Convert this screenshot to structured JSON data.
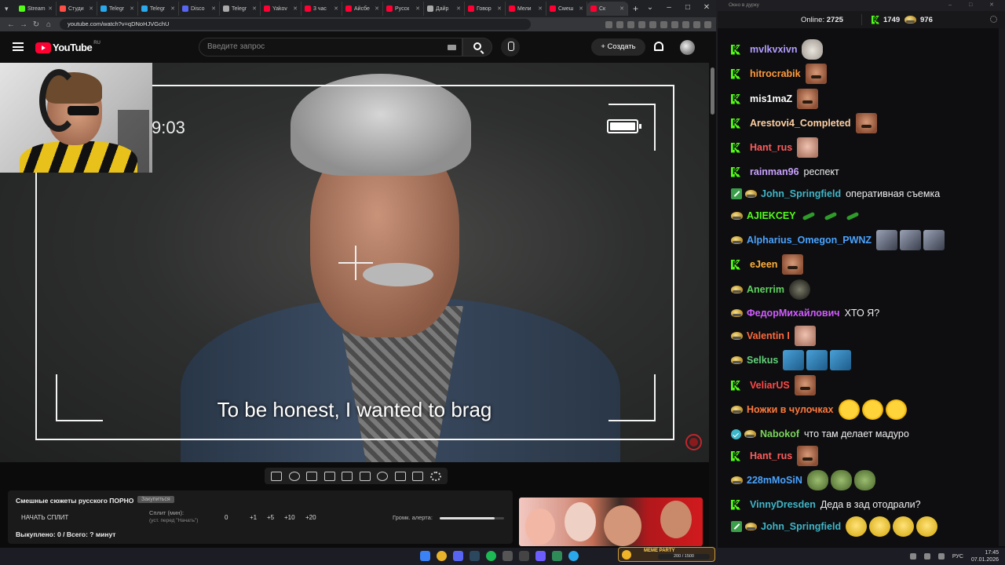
{
  "browser": {
    "tabs": [
      {
        "label": "Stream",
        "color": "#53fc18"
      },
      {
        "label": "Студи",
        "color": "#ff4e45"
      },
      {
        "label": "Telegr",
        "color": "#29a9eb"
      },
      {
        "label": "Telegr",
        "color": "#29a9eb"
      },
      {
        "label": "Disco",
        "color": "#5865f2"
      },
      {
        "label": "Telegr",
        "color": "#aaaaaa"
      },
      {
        "label": "Yakov",
        "color": "#ff0033"
      },
      {
        "label": "3 час",
        "color": "#ff0033"
      },
      {
        "label": "Айсбе",
        "color": "#ff0033"
      },
      {
        "label": "Русск",
        "color": "#ff0033"
      },
      {
        "label": "Дайр",
        "color": "#aaaaaa"
      },
      {
        "label": "Говор",
        "color": "#ff0033"
      },
      {
        "label": "Мели",
        "color": "#ff0033"
      },
      {
        "label": "Смеш",
        "color": "#ff0033"
      },
      {
        "label": "Ск",
        "color": "#ff0033"
      }
    ],
    "url": "youtube.com/watch?v=qDNoHJVGchU"
  },
  "youtube": {
    "logo_text": "YouTube",
    "region": "RU",
    "search_placeholder": "Введите запрос",
    "create_label": "Создать"
  },
  "video": {
    "timestamp": "9:03",
    "subtitle": "To be honest, I wanted to brag"
  },
  "panel": {
    "title": "Смешные сюжеты русского ПОРНО",
    "tag": "Закупиться",
    "start_split": "НАЧАТЬ СПЛИТ",
    "split_label": "Сплит (мин):",
    "split_hint": "(уст. перед \"Начать\")",
    "split_value": "0",
    "increments": [
      "+1",
      "+5",
      "+10",
      "+20"
    ],
    "volume_label": "Громк. алерта:",
    "volume_level": 0.85,
    "bought": "Выкуплено: 0 / Всего: ? минут"
  },
  "chat": {
    "window_title": "Окно в дурку",
    "online_label": "Online:",
    "online_count": "2725",
    "kick_count": "1749",
    "pot_count": "976",
    "messages": [
      {
        "badges": [
          "kick"
        ],
        "user": "mvlkvxivn",
        "color": "#b39dff",
        "text": "",
        "emotes": [
          "cat"
        ]
      },
      {
        "badges": [
          "kick"
        ],
        "user": "hitrocrabik",
        "color": "#ff9a3c",
        "text": "",
        "emotes": [
          "face"
        ]
      },
      {
        "badges": [
          "kick"
        ],
        "user": "mis1maZ",
        "color": "#ffffff",
        "text": "",
        "emotes": [
          "face"
        ]
      },
      {
        "badges": [
          "kick"
        ],
        "user": "Arestovi4_Completed",
        "color": "#ffd0a3",
        "text": "",
        "emotes": [
          "face"
        ]
      },
      {
        "badges": [
          "kick"
        ],
        "user": "Hant_rus",
        "color": "#ff5c5c",
        "text": "",
        "emotes": [
          "old"
        ]
      },
      {
        "badges": [
          "kick"
        ],
        "user": "rainman96",
        "color": "#c9a3ff",
        "text": "респект",
        "emotes": []
      },
      {
        "badges": [
          "edit",
          "pot"
        ],
        "user": "John_Springfield",
        "color": "#3fb6c9",
        "text": "оперативная съемка",
        "emotes": []
      },
      {
        "badges": [
          "pot"
        ],
        "user": "AJIEKCEY",
        "color": "#53fc18",
        "text": "",
        "emotes": [
          "bug",
          "bug",
          "bug"
        ]
      },
      {
        "badges": [
          "pot"
        ],
        "user": "Alpharius_Omegon_PWNZ",
        "color": "#4aa3ff",
        "text": "",
        "emotes": [
          "tile",
          "tile",
          "tile"
        ]
      },
      {
        "badges": [
          "kick"
        ],
        "user": "eJeen",
        "color": "#ffb03a",
        "text": "",
        "emotes": [
          "face"
        ]
      },
      {
        "badges": [
          "pot"
        ],
        "user": "Anerrim",
        "color": "#5fd35f",
        "text": "",
        "emotes": [
          "dark"
        ]
      },
      {
        "badges": [
          "pot"
        ],
        "user": "ФедорМихайлович",
        "color": "#d05cff",
        "text": "ХТО Я?",
        "emotes": []
      },
      {
        "badges": [
          "pot"
        ],
        "user": "Valentin I",
        "color": "#ff6a3d",
        "text": "",
        "emotes": [
          "old"
        ]
      },
      {
        "badges": [
          "pot"
        ],
        "user": "Selkus",
        "color": "#62d17a",
        "text": "",
        "emotes": [
          "blue",
          "blue",
          "blue"
        ]
      },
      {
        "badges": [
          "kick"
        ],
        "user": "VeliarUS",
        "color": "#ff4848",
        "text": "",
        "emotes": [
          "face"
        ]
      },
      {
        "badges": [
          "pot"
        ],
        "user": "Ножки в чулочках",
        "color": "#ff7a3c",
        "text": "",
        "emotes": [
          "laugh",
          "laugh",
          "laugh"
        ]
      },
      {
        "badges": [
          "verified",
          "pot"
        ],
        "user": "Nabokof",
        "color": "#7ad45a",
        "text": "что там делает мадуро",
        "emotes": []
      },
      {
        "badges": [
          "kick"
        ],
        "user": "Hant_rus",
        "color": "#ff5c5c",
        "text": "",
        "emotes": [
          "face"
        ]
      },
      {
        "badges": [
          "pot"
        ],
        "user": "228mMoSiN",
        "color": "#4aa3ff",
        "text": "",
        "emotes": [
          "frog",
          "frog",
          "frog"
        ]
      },
      {
        "badges": [
          "kick"
        ],
        "user": "VinnyDresden",
        "color": "#3fb6c9",
        "text": "Деда в зад отодрали?",
        "emotes": []
      },
      {
        "badges": [
          "edit",
          "pot"
        ],
        "user": "John_Springfield",
        "color": "#3fb6c9",
        "text": "",
        "emotes": [
          "smile",
          "smile",
          "smile",
          "smile"
        ]
      }
    ]
  },
  "taskbar": {
    "game_label": "MEME PARTY",
    "game_progress": "200 / 1500",
    "lang": "РУС",
    "time": "17:45",
    "date": "07.01.2026"
  }
}
